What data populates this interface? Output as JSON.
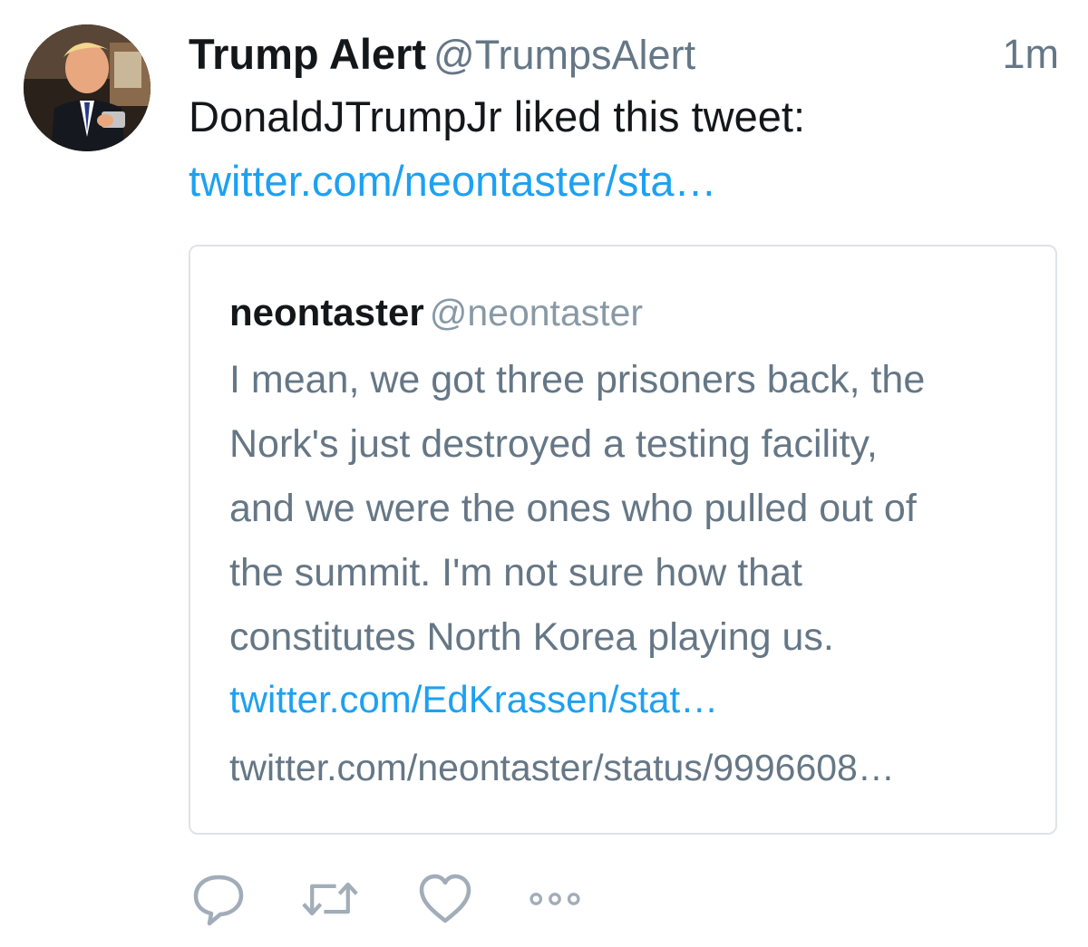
{
  "tweet": {
    "author": {
      "display_name": "Trump Alert",
      "handle": "@TrumpsAlert",
      "avatar_icon": "profile-photo"
    },
    "timestamp": "1m",
    "text": "DonaldJTrumpJr liked this tweet:",
    "link": "twitter.com/neontaster/sta…"
  },
  "quoted_tweet": {
    "display_name": "neontaster",
    "handle": "@neontaster",
    "text_lines": [
      "I mean, we got three prisoners back, the",
      "Nork's just destroyed a testing facility,",
      "and we were the ones who pulled out of",
      "the summit. I'm not sure how that",
      "constitutes North Korea playing us."
    ],
    "link": "twitter.com/EdKrassen/stat…",
    "url": "twitter.com/neontaster/status/9996608…"
  },
  "actions": [
    {
      "icon": "reply-icon"
    },
    {
      "icon": "retweet-icon"
    },
    {
      "icon": "like-icon"
    },
    {
      "icon": "more-icon"
    }
  ],
  "colors": {
    "text": "#14171a",
    "secondary": "#657786",
    "link": "#1da1f2",
    "border": "#dfe3e8"
  }
}
